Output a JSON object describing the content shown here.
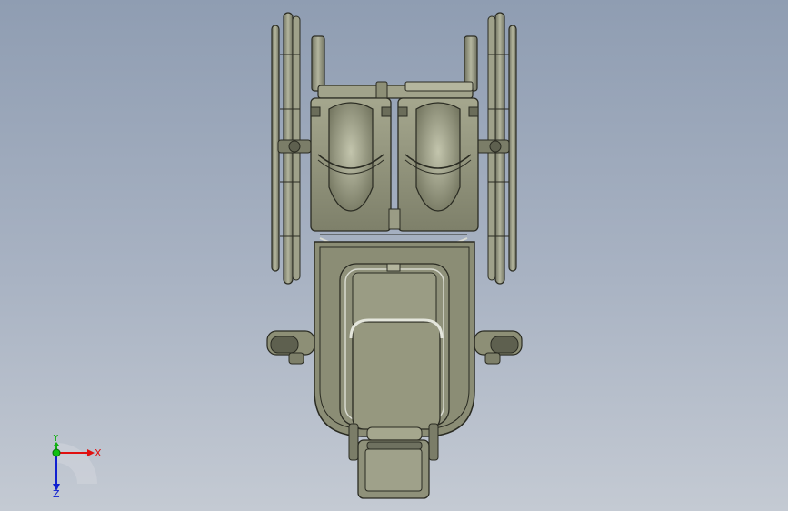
{
  "viewport": {
    "background_top": "#8f9db2",
    "background_bottom": "#c4cad3",
    "model_fill": "#8d8f76",
    "model_fill_light": "#b0b29a",
    "model_edge": "#2a2b22"
  },
  "triad": {
    "x_label": "X",
    "y_label": "Y",
    "z_label": "Z",
    "x_color": "#e01010",
    "y_color": "#10b010",
    "z_color": "#1020d0"
  }
}
